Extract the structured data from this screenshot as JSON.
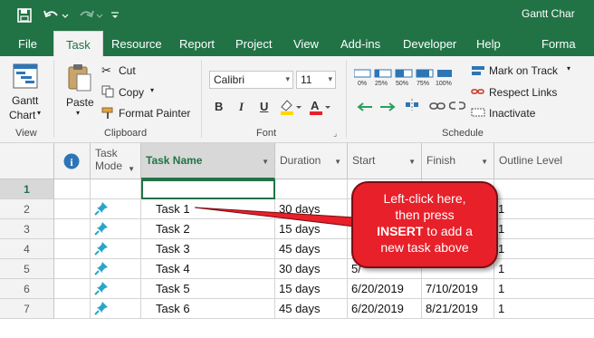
{
  "window": {
    "title": "Gantt Char"
  },
  "tabs": [
    {
      "label": "File"
    },
    {
      "label": "Task",
      "active": true
    },
    {
      "label": "Resource"
    },
    {
      "label": "Report"
    },
    {
      "label": "Project"
    },
    {
      "label": "View"
    },
    {
      "label": "Add-ins"
    },
    {
      "label": "Developer"
    },
    {
      "label": "Help"
    },
    {
      "label": "Forma"
    }
  ],
  "ribbon": {
    "view_group": {
      "gantt_label_1": "Gantt",
      "gantt_label_2": "Chart",
      "group_label": "View"
    },
    "clipboard": {
      "paste": "Paste",
      "cut": "Cut",
      "copy": "Copy",
      "format_painter": "Format Painter",
      "group_label": "Clipboard"
    },
    "font": {
      "font_name": "Calibri",
      "font_size": "11",
      "bold": "B",
      "italic": "I",
      "underline": "U",
      "group_label": "Font"
    },
    "schedule": {
      "percent_labels": [
        "0%",
        "25%",
        "50%",
        "75%",
        "100%"
      ],
      "mark_on_track": "Mark on Track",
      "respect_links": "Respect Links",
      "inactivate": "Inactivate",
      "group_label": "Schedule"
    }
  },
  "grid": {
    "headers": {
      "info": "i",
      "mode_1": "Task",
      "mode_2": "Mode",
      "name": "Task Name",
      "duration": "Duration",
      "start": "Start",
      "finish": "Finish",
      "outline": "Outline Level"
    },
    "rows": [
      {
        "num": "1",
        "name": "",
        "duration": "",
        "start": "",
        "finish": "",
        "outline": ""
      },
      {
        "num": "2",
        "name": "Task 1",
        "duration": "30 days",
        "start": "",
        "finish": "",
        "outline": "1"
      },
      {
        "num": "3",
        "name": "Task 2",
        "duration": "15 days",
        "start": "",
        "finish": "",
        "outline": "1"
      },
      {
        "num": "4",
        "name": "Task 3",
        "duration": "45 days",
        "start": "",
        "finish": "",
        "outline": "1"
      },
      {
        "num": "5",
        "name": "Task 4",
        "duration": "30 days",
        "start": "5/",
        "finish": "",
        "outline": "1"
      },
      {
        "num": "6",
        "name": "Task 5",
        "duration": "15 days",
        "start": "6/20/2019",
        "finish": "7/10/2019",
        "outline": "1"
      },
      {
        "num": "7",
        "name": "Task 6",
        "duration": "45 days",
        "start": "6/20/2019",
        "finish": "8/21/2019",
        "outline": "1"
      }
    ]
  },
  "callout": {
    "line1": "Left-click here,",
    "line2": "then press",
    "key": "INSERT",
    "line3_rest": " to add a",
    "line4": "new task above"
  },
  "colors": {
    "brand": "#217346",
    "callout": "#e8202a",
    "pin": "#2aa6c8"
  }
}
